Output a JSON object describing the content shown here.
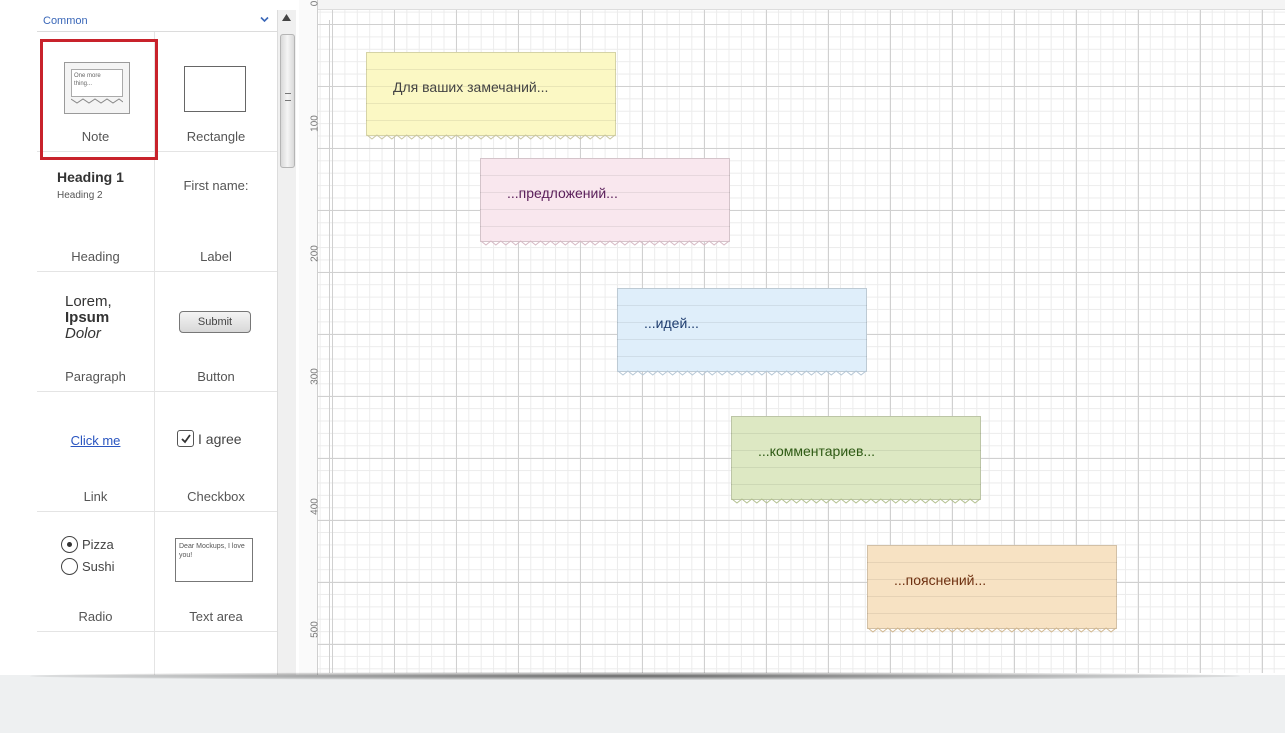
{
  "palette": {
    "section_title": "Common",
    "items": [
      {
        "label": "Note",
        "preview_text": "One more thing..."
      },
      {
        "label": "Rectangle"
      },
      {
        "label": "Heading",
        "preview_h1": "Heading 1",
        "preview_h2": "Heading 2"
      },
      {
        "label": "Label",
        "preview_text": "First name:"
      },
      {
        "label": "Paragraph",
        "preview_line1": "Lorem,",
        "preview_line2": "Ipsum",
        "preview_line3": "Dolor"
      },
      {
        "label": "Button",
        "preview_text": "Submit"
      },
      {
        "label": "Link",
        "preview_text": "Click me"
      },
      {
        "label": "Checkbox",
        "preview_text": "I agree"
      },
      {
        "label": "Radio",
        "preview_option1": "Pizza",
        "preview_option2": "Sushi"
      },
      {
        "label": "Text area",
        "preview_text": "Dear Mockups, I love you!"
      }
    ],
    "selected_item": "Note"
  },
  "ruler": {
    "labels": [
      "0",
      "100",
      "200",
      "300",
      "400",
      "500"
    ]
  },
  "notes": [
    {
      "text": "Для ваших замечаний...",
      "color": "#fbf8c4",
      "text_color": "#444444"
    },
    {
      "text": "...предложений...",
      "color": "#f9e7ee",
      "text_color": "#5a1f5a"
    },
    {
      "text": "...идей...",
      "color": "#dfeefa",
      "text_color": "#1e3c6e"
    },
    {
      "text": "...комментариев...",
      "color": "#dde8c3",
      "text_color": "#2e5a14"
    },
    {
      "text": "...пояснений...",
      "color": "#f7e2c3",
      "text_color": "#6e3010"
    }
  ]
}
